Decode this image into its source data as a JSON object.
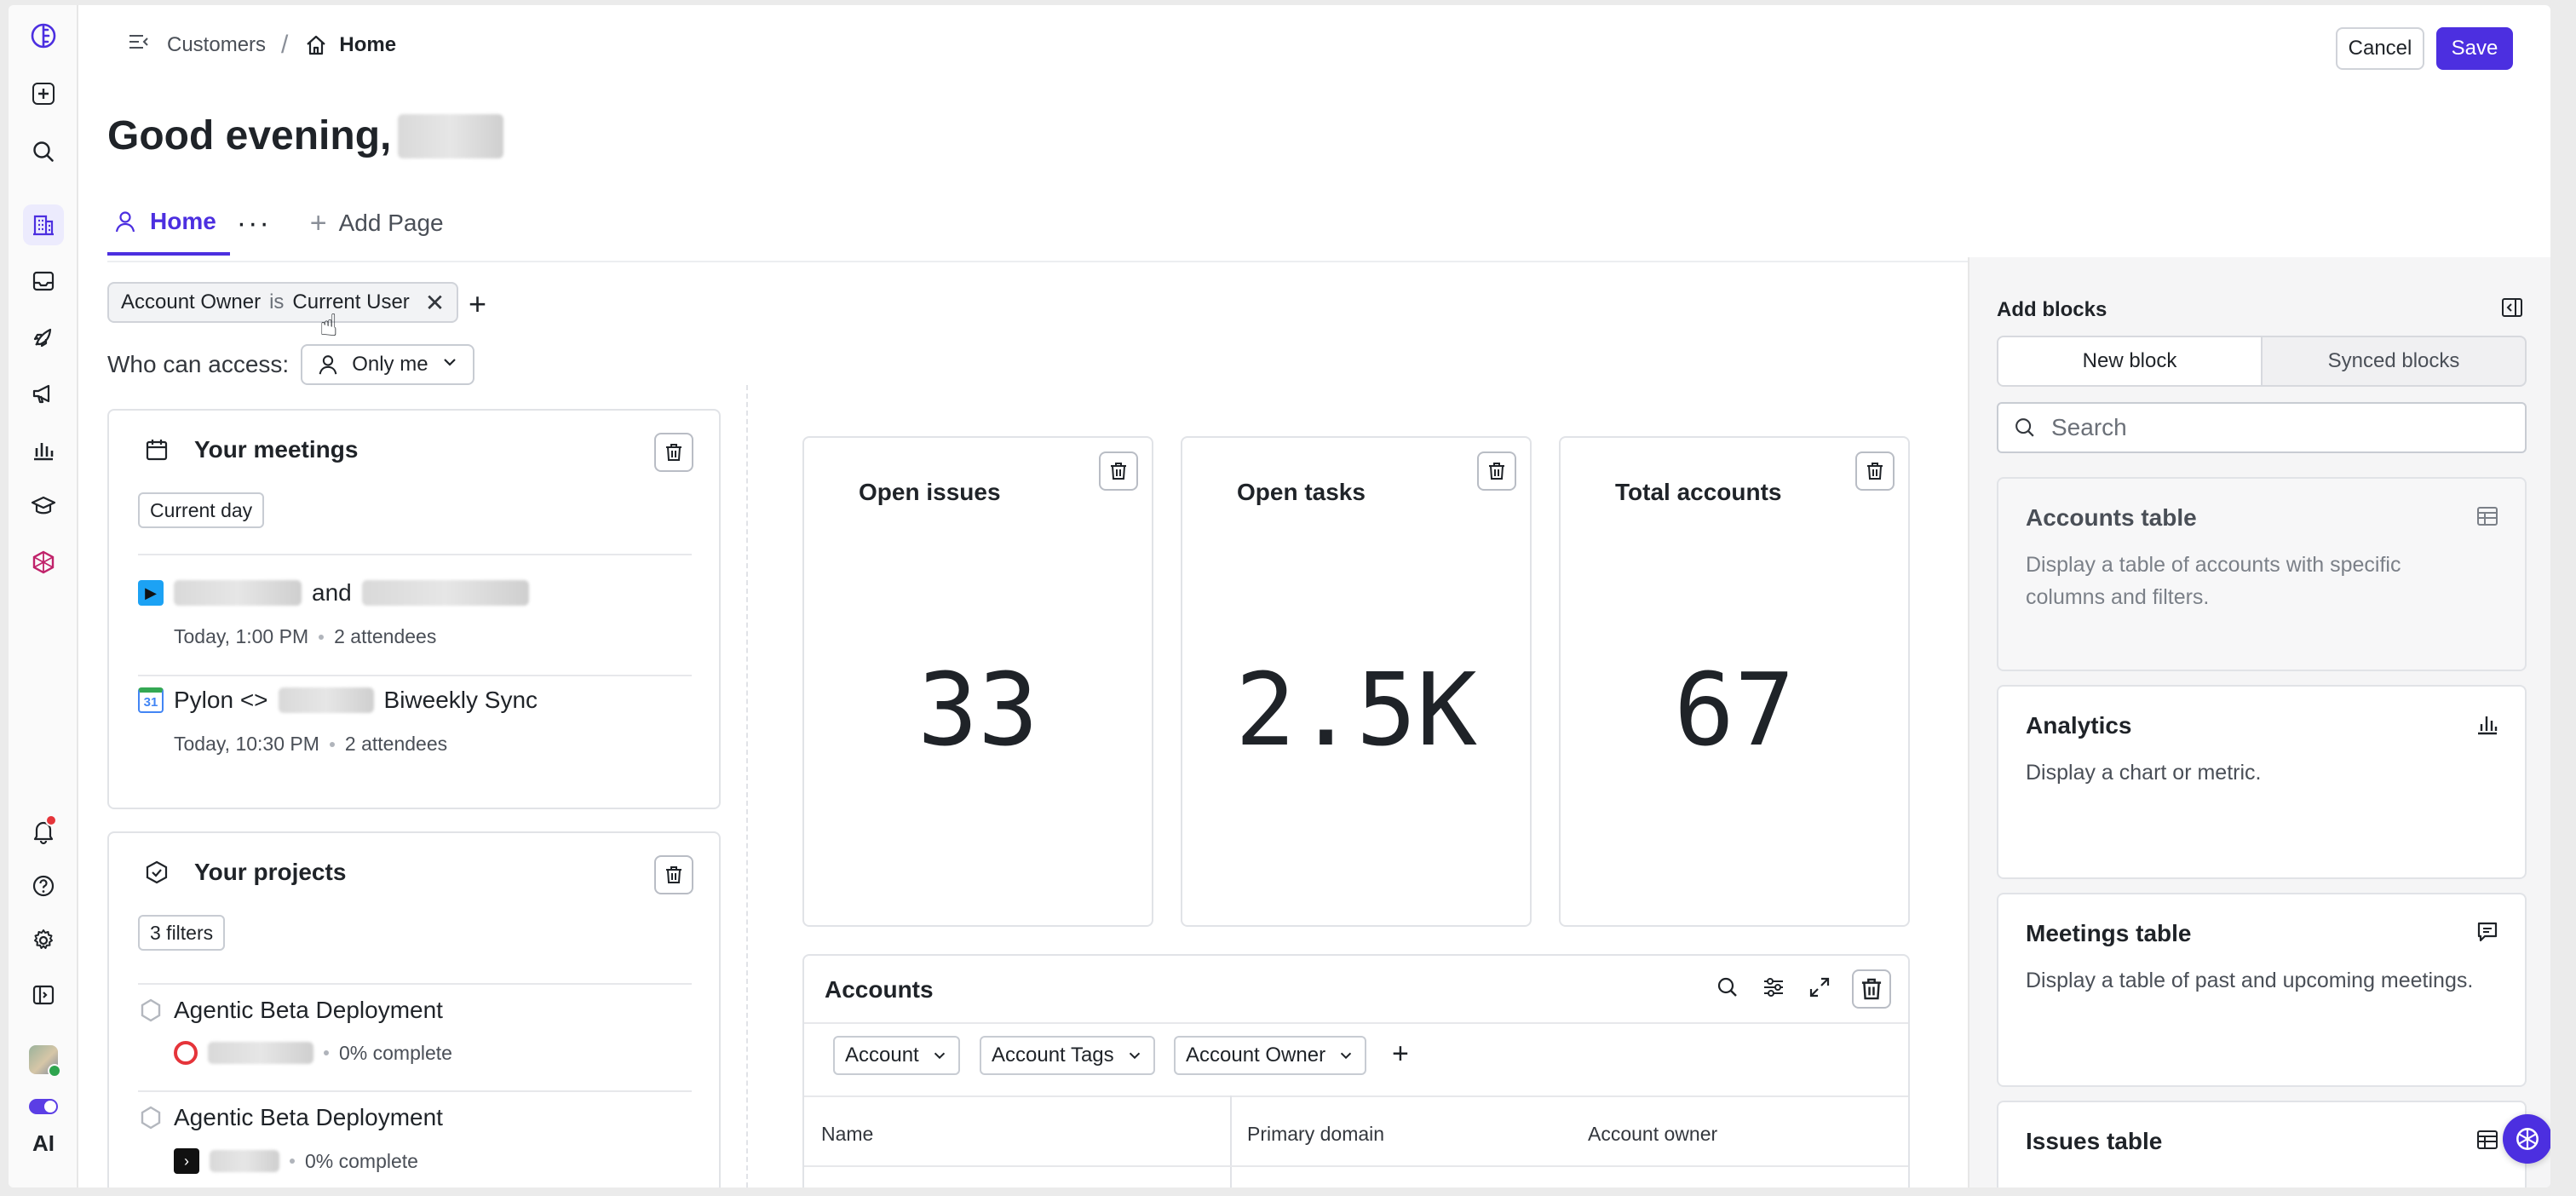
{
  "header": {
    "breadcrumb_parent": "Customers",
    "breadcrumb_separator": "/",
    "breadcrumb_current": "Home",
    "cancel_label": "Cancel",
    "save_label": "Save"
  },
  "greeting": "Good evening,",
  "tabs": {
    "home": "Home",
    "more": "···",
    "add_page": "Add Page"
  },
  "filter": {
    "field": "Account Owner",
    "operator": "is",
    "value": "Current User",
    "access_label": "Who can access:",
    "access_value": "Only me"
  },
  "meetings": {
    "title": "Your meetings",
    "pill": "Current day",
    "items": [
      {
        "title_joiner": "and",
        "time": "Today, 1:00 PM",
        "attendees": "2 attendees"
      },
      {
        "title_prefix": "Pylon <>",
        "title_suffix": "Biweekly Sync",
        "time": "Today, 10:30 PM",
        "attendees": "2 attendees"
      }
    ]
  },
  "projects": {
    "title": "Your projects",
    "pill": "3 filters",
    "items": [
      {
        "title": "Agentic Beta Deployment",
        "progress": "0% complete"
      },
      {
        "title": "Agentic Beta Deployment",
        "progress": "0% complete"
      }
    ]
  },
  "stats": [
    {
      "label": "Open issues",
      "value": "33"
    },
    {
      "label": "Open tasks",
      "value": "2.5K"
    },
    {
      "label": "Total accounts",
      "value": "67"
    }
  ],
  "accounts": {
    "title": "Accounts",
    "filters": [
      "Account",
      "Account Tags",
      "Account Owner"
    ],
    "columns": [
      "Name",
      "Primary domain",
      "Account owner"
    ]
  },
  "panel": {
    "title": "Add blocks",
    "tab_new": "New block",
    "tab_synced": "Synced blocks",
    "search_placeholder": "Search",
    "blocks": [
      {
        "title": "Accounts table",
        "desc": "Display a table of accounts with specific columns and filters."
      },
      {
        "title": "Analytics",
        "desc": "Display a chart or metric."
      },
      {
        "title": "Meetings table",
        "desc": "Display a table of past and upcoming meetings."
      },
      {
        "title": "Issues table",
        "desc": ""
      }
    ]
  },
  "rail": {
    "ai_label": "AI"
  },
  "colors": {
    "accent": "#4c2fe0",
    "notification": "#e5343a"
  }
}
